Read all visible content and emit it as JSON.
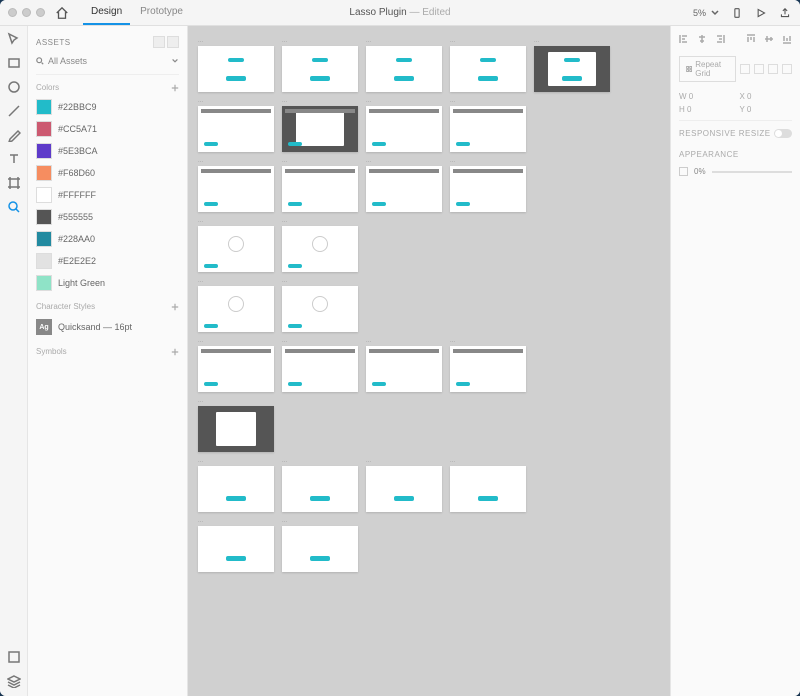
{
  "titlebar": {
    "tabs": [
      "Design",
      "Prototype"
    ],
    "activeTab": 0,
    "docTitle": "Lasso Plugin",
    "editedLabel": "— Edited",
    "zoom": "5%"
  },
  "leftPanel": {
    "title": "ASSETS",
    "searchLabel": "All Assets",
    "sections": {
      "colors": {
        "title": "Colors",
        "items": [
          {
            "hex": "#22BBC9",
            "label": "#22BBC9"
          },
          {
            "hex": "#CC5A71",
            "label": "#CC5A71"
          },
          {
            "hex": "#5E3BCA",
            "label": "#5E3BCA"
          },
          {
            "hex": "#F68D60",
            "label": "#F68D60"
          },
          {
            "hex": "#FFFFFF",
            "label": "#FFFFFF"
          },
          {
            "hex": "#555555",
            "label": "#555555"
          },
          {
            "hex": "#228AA0",
            "label": "#228AA0"
          },
          {
            "hex": "#E2E2E2",
            "label": "#E2E2E2"
          },
          {
            "hex": "#8FE3C7",
            "label": "Light Green"
          }
        ]
      },
      "charStyles": {
        "title": "Character Styles",
        "items": [
          {
            "label": "Quicksand — 16pt",
            "iconText": "Ag"
          }
        ]
      },
      "symbols": {
        "title": "Symbols"
      }
    }
  },
  "rightPanel": {
    "repeatGrid": "Repeat Grid",
    "coords": {
      "w": "W 0",
      "x": "X 0",
      "h": "H 0",
      "y": "Y 0"
    },
    "responsive": "RESPONSIVE RESIZE",
    "appearance": "APPEARANCE",
    "opacity": "0%"
  },
  "colors": {
    "accent": "#1492E6",
    "teal": "#22BBC9"
  },
  "canvas": {
    "rows": [
      {
        "count": 5,
        "variant": "landing",
        "lastDark": true
      },
      {
        "count": 4,
        "variant": "app",
        "secondDark": true
      },
      {
        "count": 4,
        "variant": "app"
      },
      {
        "count": 2,
        "variant": "form"
      },
      {
        "count": 2,
        "variant": "form"
      },
      {
        "count": 4,
        "variant": "app"
      },
      {
        "count": 1,
        "variant": "dark-app"
      },
      {
        "count": 4,
        "variant": "card"
      },
      {
        "count": 2,
        "variant": "card"
      }
    ]
  }
}
